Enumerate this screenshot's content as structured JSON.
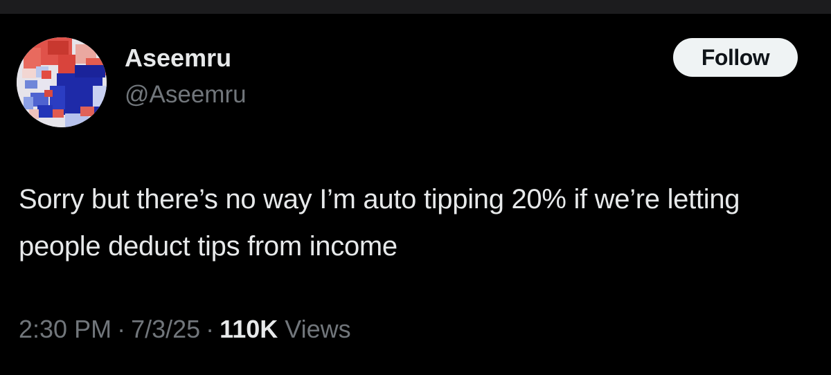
{
  "tweet": {
    "author": {
      "display_name": "Aseemru",
      "handle": "@Aseemru",
      "avatar_icon": "avatar-image"
    },
    "follow_label": "Follow",
    "text": "Sorry but there’s no way I’m auto tipping 20% if we’re letting people deduct tips from income",
    "time": "2:30 PM",
    "date": "7/3/25",
    "separator": "·",
    "views_count": "110K",
    "views_label": "Views"
  },
  "colors": {
    "background": "#000000",
    "primary_text": "#e7e9ea",
    "secondary_text": "#71767b",
    "button_bg": "#eff3f4",
    "button_text": "#0f1419"
  }
}
